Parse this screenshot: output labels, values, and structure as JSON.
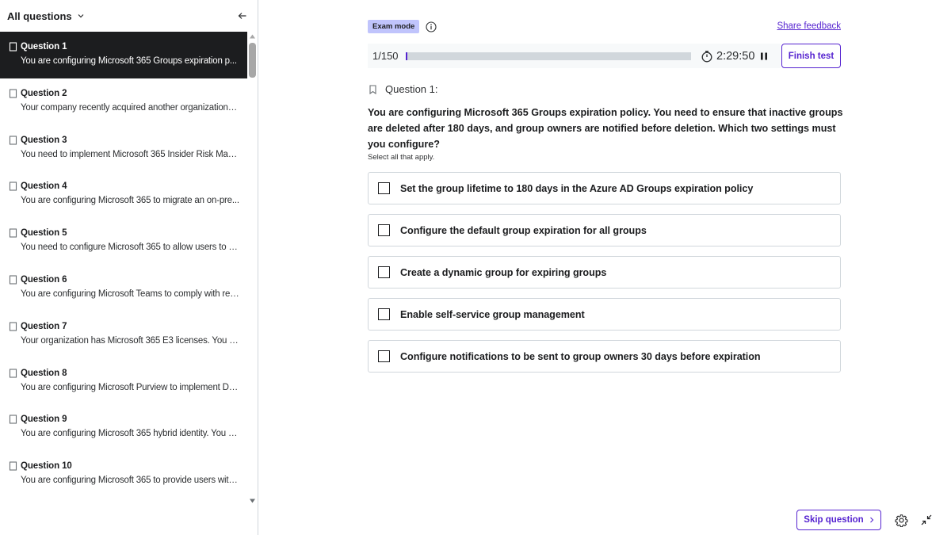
{
  "sidebar": {
    "title": "All questions",
    "items": [
      {
        "label": "Question 1",
        "text": "You are configuring Microsoft 365 Groups expiration p...",
        "active": true
      },
      {
        "label": "Question 2",
        "text": "Your company recently acquired another organization. Y..."
      },
      {
        "label": "Question 3",
        "text": "You need to implement Microsoft 365 Insider Risk Man..."
      },
      {
        "label": "Question 4",
        "text": "You are configuring Microsoft 365 to migrate an on-pre..."
      },
      {
        "label": "Question 5",
        "text": "You need to configure Microsoft 365 to allow users to s..."
      },
      {
        "label": "Question 6",
        "text": "You are configuring Microsoft Teams to comply with reg..."
      },
      {
        "label": "Question 7",
        "text": "Your organization has Microsoft 365 E3 licenses. You n..."
      },
      {
        "label": "Question 8",
        "text": "You are configuring Microsoft Purview to implement Da..."
      },
      {
        "label": "Question 9",
        "text": "You are configuring Microsoft 365 hybrid identity. You n..."
      },
      {
        "label": "Question 10",
        "text": "You are configuring Microsoft 365 to provide users with..."
      }
    ]
  },
  "header": {
    "mode_badge": "Exam mode",
    "share_feedback": "Share feedback",
    "progress_count": "1/150",
    "progress_fraction": 0.0067,
    "timer": "2:29:50",
    "finish_button": "Finish test"
  },
  "question": {
    "heading": "Question 1:",
    "body": "You are configuring Microsoft 365 Groups expiration policy. You need to ensure that inactive groups are deleted after 180 days, and group owners are notified before deletion. Which two settings must you configure?",
    "hint": "Select all that apply.",
    "options": [
      "Set the group lifetime to 180 days in the Azure AD Groups expiration policy",
      "Configure the default group expiration for all groups",
      "Create a dynamic group for expiring groups",
      "Enable self-service group management",
      "Configure notifications to be sent to group owners 30 days before expiration"
    ]
  },
  "footer": {
    "skip_button": "Skip question"
  },
  "colors": {
    "accent": "#5624d0",
    "badge_bg": "#c0c4fc",
    "active_item_bg": "#1c1d1f",
    "border": "#d1d7dc"
  },
  "icons": [
    "chevron-down-icon",
    "collapse-arrow-icon",
    "bookmark-icon",
    "info-icon",
    "stopwatch-icon",
    "pause-icon",
    "chevron-right-icon",
    "gear-icon",
    "minimize-icon"
  ]
}
